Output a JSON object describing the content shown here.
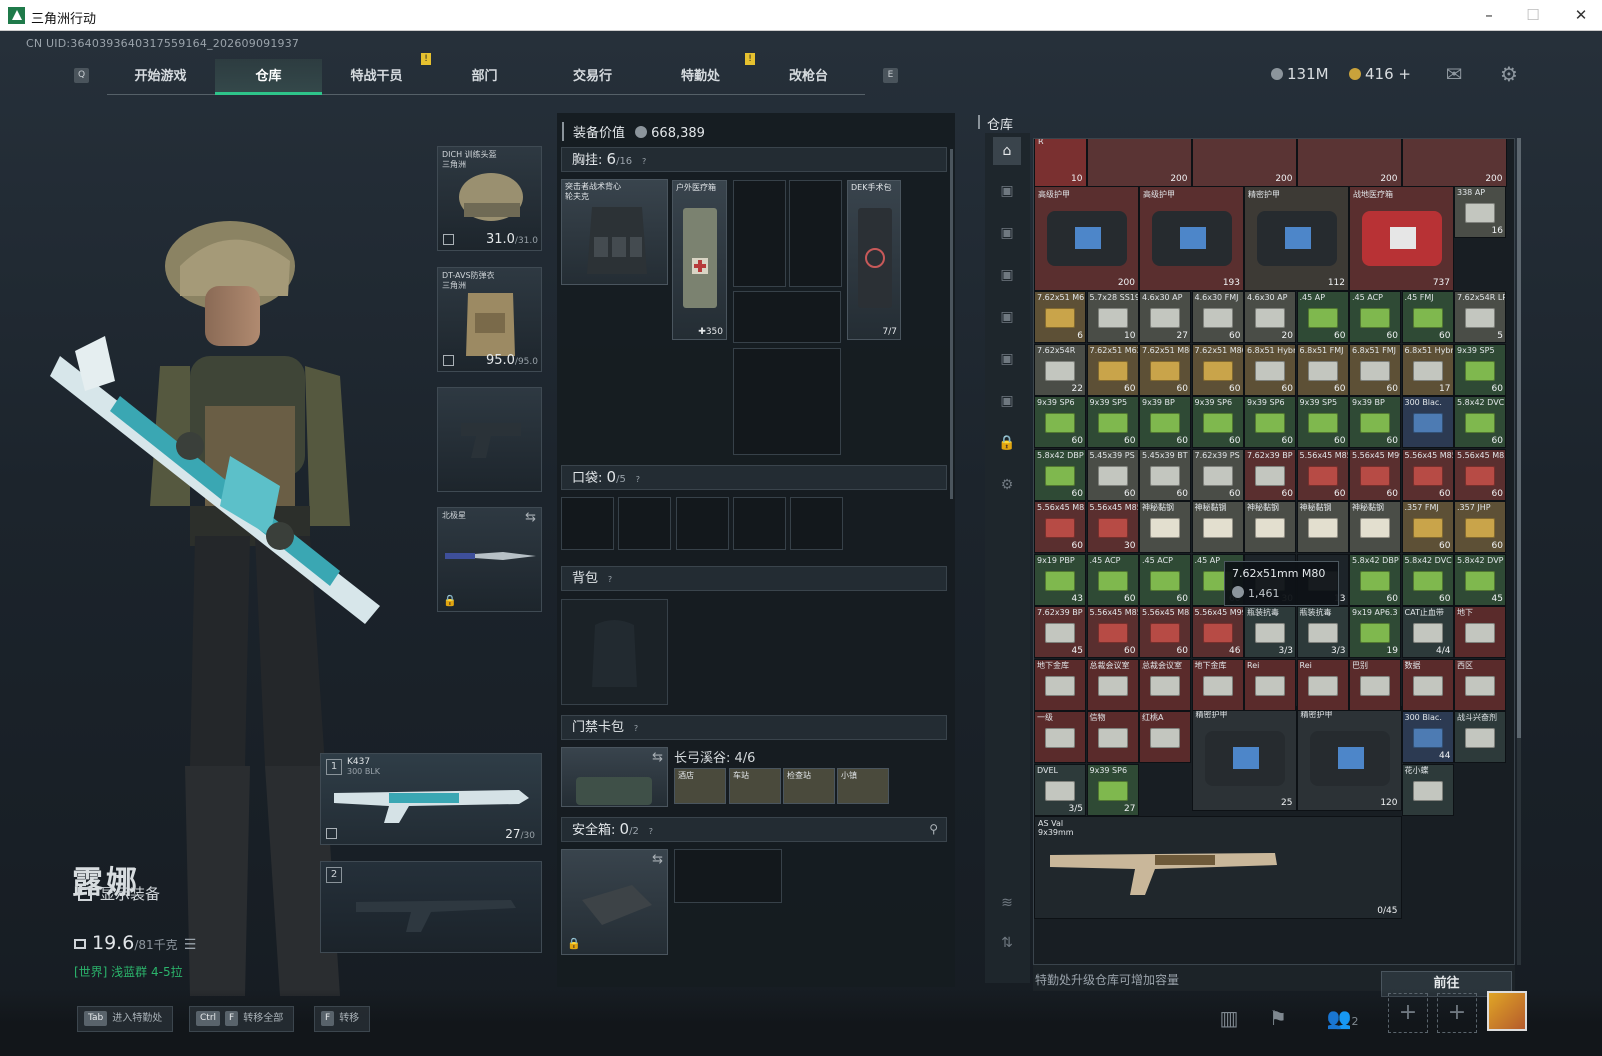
{
  "window": {
    "title": "三角洲行动",
    "minimize": "–",
    "maximize": "☐",
    "close": "✕"
  },
  "uid": "CN UID:3640393640317559164_202609091937",
  "nav": {
    "key_left": "Q",
    "key_right": "E",
    "tabs": [
      "开始游戏",
      "仓库",
      "特战干员",
      "部门",
      "交易行",
      "特勤处",
      "改枪台"
    ],
    "active": "仓库",
    "marks": [
      "!",
      "!"
    ]
  },
  "currency": {
    "hafu": "131M",
    "coin": "416",
    "plus": "+"
  },
  "character": {
    "name": "露娜",
    "show_gear": "显示装备",
    "weight": "19.6",
    "weight_max": "/81千克",
    "region": "[世界] 浅蓝群 4-5拉"
  },
  "equipment": {
    "helmet": {
      "label": "DICH 训练头盔\n三角洲",
      "dur": "31.0",
      "max": "/31.0"
    },
    "armor": {
      "label": "DT-AVS防弹衣\n三角洲",
      "dur": "95.0",
      "max": "/95.0"
    },
    "melee": {
      "label": "北极星"
    },
    "primary": {
      "slot": "1",
      "label": "K437",
      "sub": "300 BLK",
      "ammo": "27",
      "ammo_max": "/30"
    },
    "secondary": {
      "slot": "2"
    }
  },
  "loadout": {
    "value_label": "装备价值",
    "value": "668,389",
    "chest_label": "胸挂:",
    "chest_count": "6",
    "chest_max": "/16",
    "chest_item": "突击者战术背心\n轮夫克",
    "chest_items": [
      {
        "name": "户外医疗箱",
        "count": "350",
        "icon": "medkit"
      },
      {
        "name": "DEK手术包",
        "count": "7/7",
        "icon": "surgery-kit"
      }
    ],
    "pocket_label": "口袋:",
    "pocket_count": "0",
    "pocket_max": "/5",
    "backpack_label": "背包",
    "keycard_label": "门禁卡包",
    "keycard_area": "长弓溪谷: 4/6",
    "keycards": [
      "酒店",
      "车站",
      "检查站",
      "小镇"
    ],
    "safe_label": "安全箱:",
    "safe_count": "0",
    "safe_max": "/2",
    "help": "?"
  },
  "storage": {
    "title": "仓库",
    "upgrade_hint": "特勤处升级仓库可增加容量",
    "go_button": "前往",
    "tooltip": {
      "name": "7.62x51mm M80",
      "price": "1,461"
    },
    "row0": [
      {
        "name": "R",
        "count": "10",
        "color": "#7a3030"
      },
      {
        "name": "",
        "count": "200",
        "color": "#5a3434"
      },
      {
        "name": "",
        "count": "200",
        "color": "#5a3434"
      },
      {
        "name": "",
        "count": "200",
        "color": "#5a3434"
      },
      {
        "name": "",
        "count": "200",
        "color": "#5a3434"
      }
    ],
    "big_items": [
      {
        "name": "高级护甲",
        "count": "200"
      },
      {
        "name": "高级护甲",
        "count": "193"
      },
      {
        "name": "精密护甲",
        "count": "112"
      },
      {
        "name": "战地医疗箱",
        "count": "737"
      },
      {
        "name": "精密护甲",
        "count": "25"
      },
      {
        "name": "精密护甲",
        "count": "120"
      }
    ],
    "grid": [
      [
        "338 AP|16",
        "",
        "",
        "",
        "",
        "",
        "",
        "",
        "",
        ""
      ],
      [
        "7.62x51 M61|6",
        "5.7x28 SS190|10",
        "4.6x30 AP|27",
        "4.6x30 FMJ|60",
        "4.6x30 AP|20",
        ".45 AP|60",
        ".45 ACP|60",
        ".45 FMJ|60",
        "7.62x54R LPS|5",
        ""
      ],
      [
        "7.62x54R|22",
        "7.62x51 M62|60",
        "7.62x51 M80|60",
        "7.62x51 M80|60",
        "6.8x51 Hybrid|60",
        "6.8x51 FMJ|60",
        "6.8x51 FMJ|60",
        "6.8x51 Hybrid|17",
        "9x39 SP5|60",
        ""
      ],
      [
        "9x39 SP6|60",
        "9x39 SP5|60",
        "9x39 BP|60",
        "9x39 SP6|60",
        "9x39 SP6|60",
        "9x39 SP5|60",
        "9x39 BP|60",
        "300 Blac.|",
        "5.8x42 DVC|60",
        ""
      ],
      [
        "5.8x42 DBP|60",
        "5.45x39 PS|60",
        "5.45x39 BT|60",
        "7.62x39 PS|60",
        "7.62x39 BP|60",
        "5.56x45 M855|60",
        "5.56x45 M995|60",
        "5.56x45 M855|60",
        "5.56x45 M856|60",
        ""
      ],
      [
        "5.56x45 M855|60",
        "5.56x45 M856|30",
        "神秘黏钢|",
        "神秘黏钢|",
        "神秘黏钢|",
        "神秘黏钢|",
        "神秘黏钢|",
        ".357 FMJ|60",
        ".357 JHP|60",
        ""
      ],
      [
        "9x19 PBP|43",
        ".45 ACP|60",
        ".45 ACP|60",
        ".45 AP|60",
        "|30",
        "|13",
        "5.8x42 DBP|60",
        "5.8x42 DVC|60",
        "5.8x42 DVP|45",
        ""
      ],
      [
        "7.62x39 BP|45",
        "5.56x45 M855|60",
        "5.56x45 M856|60",
        "5.56x45 M995|46",
        "瓶装抗毒|3/3",
        "瓶装抗毒|3/3",
        "9x19 AP6.3|19",
        "CAT止血带|4/4",
        "地下|",
        ""
      ],
      [
        "地下金库|",
        "总裁会议室|",
        "总裁会议室|",
        "地下金库|",
        "Rei|",
        "Rei|",
        "巴别|",
        "数据|",
        "西区|",
        ""
      ],
      [
        "一级|",
        "信物|",
        "红桃A|",
        "",
        "",
        "",
        "",
        "300 Blac.|44",
        "战斗兴奋剂|",
        ""
      ],
      [
        "DVEL|3/5",
        "9x39 SP6|27",
        "",
        "",
        "",
        "",
        "",
        "花小蝶|",
        "",
        ""
      ]
    ],
    "rifle": {
      "name": "AS Val",
      "sub": "9x39mm",
      "count": "0/45"
    }
  },
  "bottom": {
    "hints": [
      {
        "keys": [
          "Tab"
        ],
        "label": "进入特勤处"
      },
      {
        "keys": [
          "Ctrl",
          "F"
        ],
        "label": "转移全部"
      },
      {
        "keys": [
          "F"
        ],
        "label": "转移"
      }
    ],
    "friends": "2"
  }
}
